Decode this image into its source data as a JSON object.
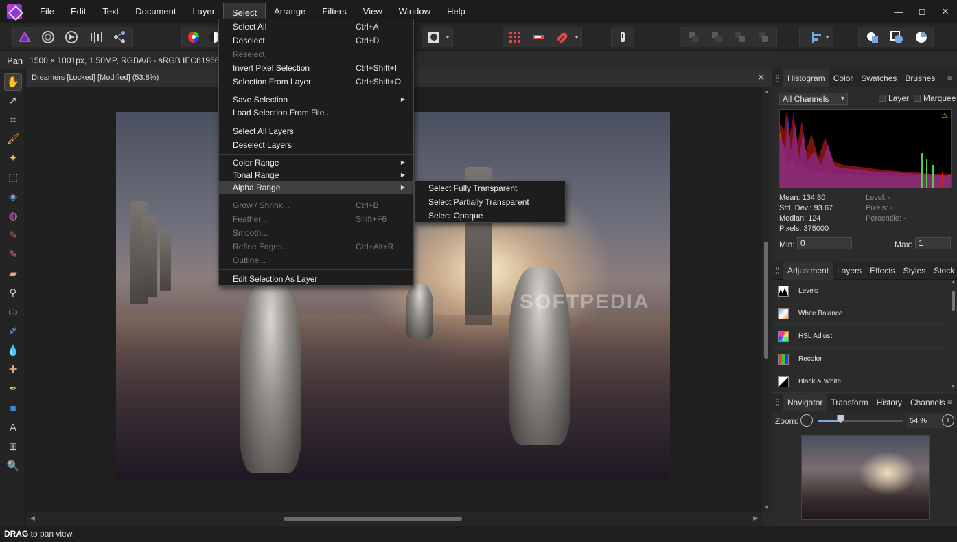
{
  "menubar": {
    "items": [
      "File",
      "Edit",
      "Text",
      "Document",
      "Layer",
      "Select",
      "Arrange",
      "Filters",
      "View",
      "Window",
      "Help"
    ],
    "active": "Select"
  },
  "window": {
    "minimize": "—",
    "maximize": "◻",
    "close": "✕"
  },
  "context": {
    "tool": "Pan",
    "info": "1500 × 1001px, 1.50MP, RGBA/8 - sRGB IEC61966-2"
  },
  "document": {
    "title": "Dreamers [Locked] [Modified] (53.8%)",
    "close": "✕",
    "watermark": "SOFTPEDIA"
  },
  "select_menu": {
    "items": [
      {
        "label": "Select All",
        "shortcut": "Ctrl+A"
      },
      {
        "label": "Deselect",
        "shortcut": "Ctrl+D"
      },
      {
        "label": "Reselect",
        "shortcut": ""
      },
      {
        "label": "Invert Pixel Selection",
        "shortcut": "Ctrl+Shift+I"
      },
      {
        "label": "Selection From Layer",
        "shortcut": "Ctrl+Shift+O"
      },
      {
        "label": "Save Selection",
        "shortcut": ""
      },
      {
        "label": "Load Selection From File...",
        "shortcut": ""
      },
      {
        "label": "Select All Layers",
        "shortcut": ""
      },
      {
        "label": "Deselect Layers",
        "shortcut": ""
      },
      {
        "label": "Color Range",
        "shortcut": ""
      },
      {
        "label": "Tonal Range",
        "shortcut": ""
      },
      {
        "label": "Alpha Range",
        "shortcut": ""
      },
      {
        "label": "Grow / Shrink...",
        "shortcut": "Ctrl+B"
      },
      {
        "label": "Feather...",
        "shortcut": "Shift+F6"
      },
      {
        "label": "Smooth...",
        "shortcut": ""
      },
      {
        "label": "Refine Edges...",
        "shortcut": "Ctrl+Alt+R"
      },
      {
        "label": "Outline...",
        "shortcut": ""
      },
      {
        "label": "Edit Selection As Layer",
        "shortcut": ""
      }
    ],
    "submenu_arrow": "▶"
  },
  "alpha_submenu": {
    "items": [
      "Select Fully Transparent",
      "Select Partially Transparent",
      "Select Opaque"
    ]
  },
  "histogram_panel": {
    "tabs": [
      "Histogram",
      "Color",
      "Swatches",
      "Brushes"
    ],
    "channel": "All Channels",
    "layer_label": "Layer",
    "marquee_label": "Marquee",
    "warning": "⚠",
    "mean": "Mean: 134.80",
    "stddev": "Std. Dev.: 93.67",
    "median": "Median: 124",
    "pixels": "Pixels: 375000",
    "level": "Level: -",
    "pixels_r": "Pixels: -",
    "percentile": "Percentile: -",
    "min_label": "Min:",
    "min_value": "0",
    "max_label": "Max:",
    "max_value": "1"
  },
  "adjustment_panel": {
    "tabs": [
      "Adjustment",
      "Layers",
      "Effects",
      "Styles",
      "Stock"
    ],
    "items": [
      "Levels",
      "White Balance",
      "HSL Adjust",
      "Recolor",
      "Black & White"
    ]
  },
  "navigator_panel": {
    "tabs": [
      "Navigator",
      "Transform",
      "History",
      "Channels"
    ],
    "zoom_label": "Zoom:",
    "zoom_value": "54 %",
    "zoom_fraction": 0.27,
    "minus": "−",
    "plus": "+"
  },
  "status": {
    "key": "DRAG",
    "text": " to pan view."
  },
  "colors": {
    "accent": "#7aa9e0",
    "menu_bg": "#1d1d1d",
    "highlight": "#3f3f3f"
  }
}
